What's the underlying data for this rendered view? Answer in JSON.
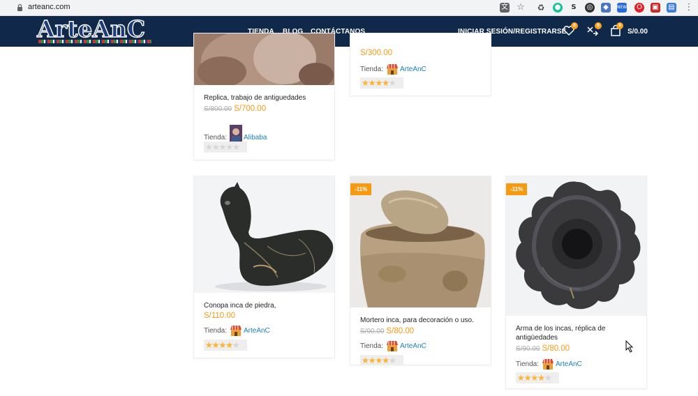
{
  "browser": {
    "url": "arteanc.com"
  },
  "header": {
    "logo_text": "ArteAnC",
    "nav": [
      "TIENDA",
      "BLOG",
      "CONTÁCTANOS"
    ],
    "login": "INICIAR SESIÓN/REGISTRARSE",
    "wishlist_count": "0",
    "compare_count": "0",
    "cart_count": "0",
    "cart_total": "S/0.00"
  },
  "colors": {
    "header_bg": "#10294a",
    "price": "#f79a13",
    "link": "#1a7fb9",
    "badge": "#f7a324"
  },
  "products": [
    {
      "title": "Replica, trabajo de antiguedades",
      "old_price": "S/800.00",
      "price": "S/700.00",
      "store_label": "Tienda:",
      "store": "Alibaba",
      "rating": 0
    },
    {
      "title": "",
      "old_price": "",
      "price": "S/300.00",
      "store_label": "Tienda:",
      "store": "ArteAnC",
      "rating": 0.8
    },
    {
      "title": "Conopa inca de piedra,",
      "old_price": "",
      "price": "S/110.00",
      "store_label": "Tienda:",
      "store": "ArteAnC",
      "rating": 0.8
    },
    {
      "badge": "-11%",
      "title": "Mortero inca, para decoración o uso.",
      "old_price": "S/90.00",
      "price": "S/80.00",
      "store_label": "Tienda:",
      "store": "ArteAnC",
      "rating": 0.8
    },
    {
      "badge": "-11%",
      "title": "Arma de los incas, réplica de antigüedades",
      "old_price": "S/90.00",
      "price": "S/80.00",
      "store_label": "Tienda:",
      "store": "ArteAnC",
      "rating": 0.8
    }
  ]
}
